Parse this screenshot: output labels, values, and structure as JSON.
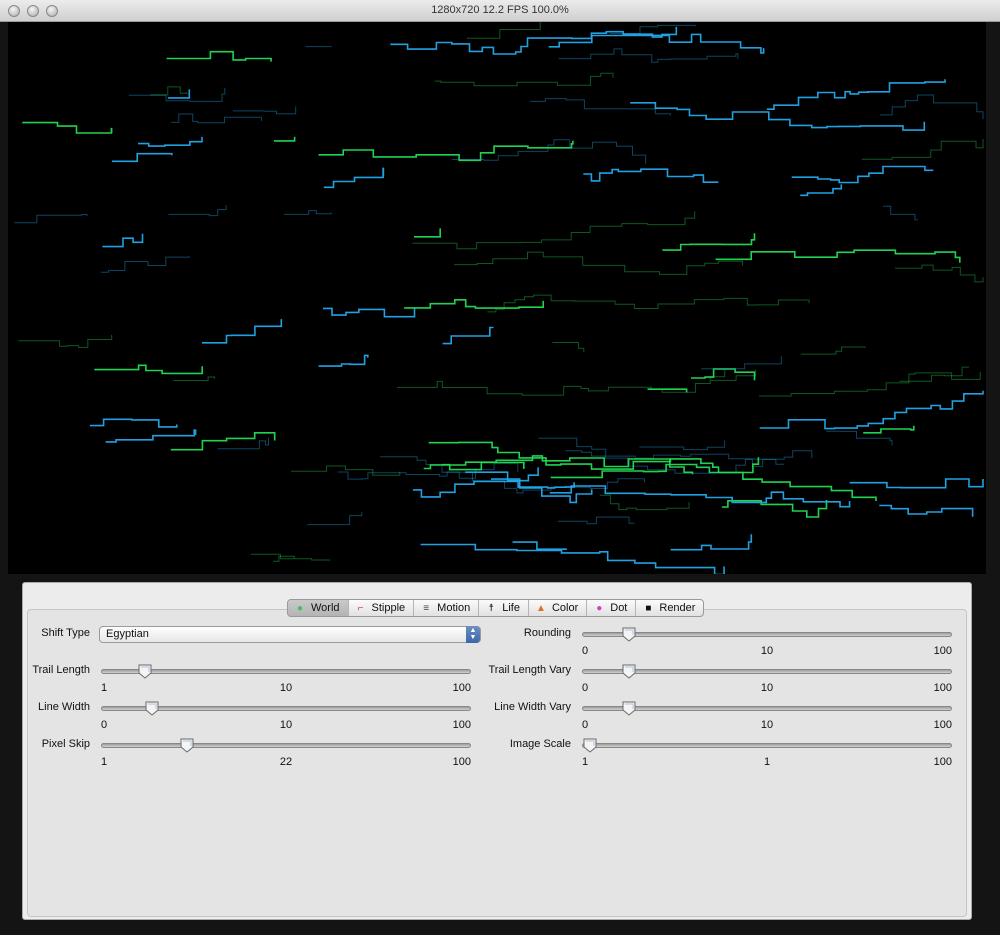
{
  "window": {
    "title": "1280x720 12.2 FPS 100.0%"
  },
  "tabs": [
    {
      "label": "World",
      "icon": "world-icon",
      "icon_color": "#3fbf6a",
      "active": true
    },
    {
      "label": "Stipple",
      "icon": "stipple-icon",
      "icon_color": "#cc3333",
      "active": false
    },
    {
      "label": "Motion",
      "icon": "motion-icon",
      "icon_color": "#444444",
      "active": false
    },
    {
      "label": "Life",
      "icon": "life-icon",
      "icon_color": "#222222",
      "active": false
    },
    {
      "label": "Color",
      "icon": "color-icon",
      "icon_color": "#e07020",
      "active": false
    },
    {
      "label": "Dot",
      "icon": "dot-icon",
      "icon_color": "#d040c0",
      "active": false
    },
    {
      "label": "Render",
      "icon": "camera-icon",
      "icon_color": "#111111",
      "active": false
    }
  ],
  "shift_type": {
    "label": "Shift Type",
    "value": "Egyptian"
  },
  "left_sliders": [
    {
      "label": "Trail Length",
      "min": "1",
      "mid": "10",
      "max": "100",
      "level": 0.1
    },
    {
      "label": "Line Width",
      "min": "0",
      "mid": "10",
      "max": "100",
      "level": 0.12
    },
    {
      "label": "Pixel Skip",
      "min": "1",
      "mid": "22",
      "max": "100",
      "level": 0.22
    }
  ],
  "right_sliders": [
    {
      "label": "Rounding",
      "min": "0",
      "mid": "10",
      "max": "100",
      "level": 0.11
    },
    {
      "label": "Trail Length Vary",
      "min": "0",
      "mid": "10",
      "max": "100",
      "level": 0.11
    },
    {
      "label": "Line Width Vary",
      "min": "0",
      "mid": "10",
      "max": "100",
      "level": 0.11
    },
    {
      "label": "Image Scale",
      "min": "1",
      "mid": "1",
      "max": "100",
      "level": 0.0
    }
  ],
  "colors": {
    "trail_green": "#22dd55",
    "trail_cyan": "#22aaee",
    "background": "#000000"
  }
}
